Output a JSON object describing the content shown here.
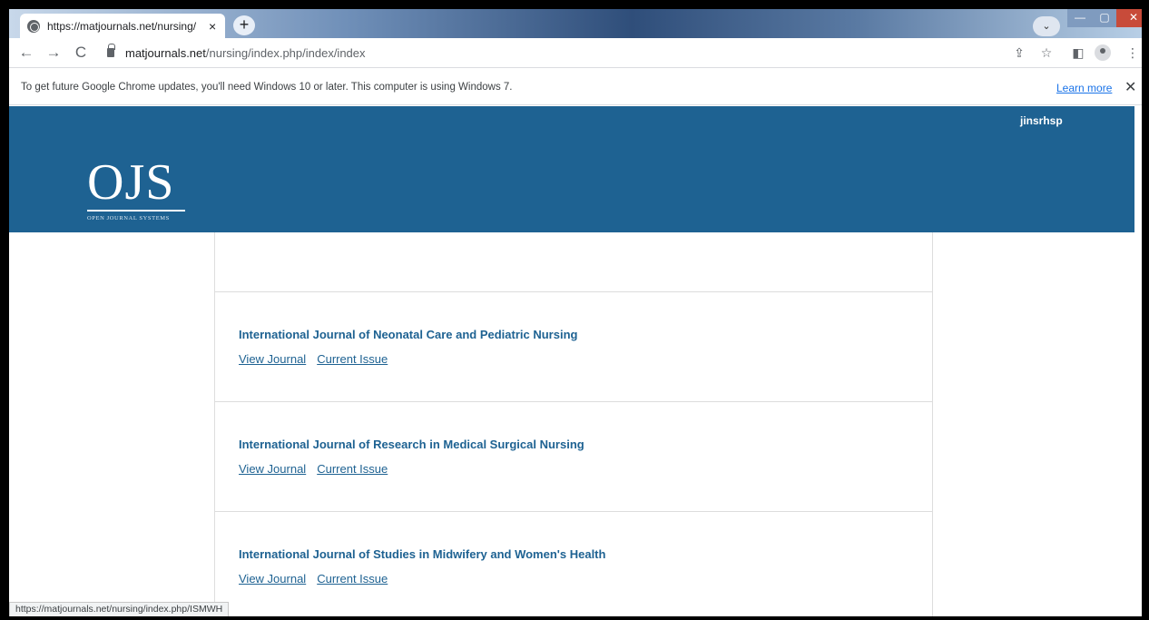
{
  "browser": {
    "tab": {
      "title": "https://matjournals.net/nursing/",
      "favicon": "globe-icon",
      "close": "×"
    },
    "new_tab": "+",
    "tab_search": "⌄",
    "window_controls": {
      "minimize": "—",
      "maximize": "▢",
      "close": "✕"
    },
    "url_host": "matjournals.net",
    "url_path": "/nursing/index.php/index/index",
    "icons": {
      "back": "←",
      "forward": "→",
      "reload": "C",
      "share": "⇪",
      "star": "☆",
      "side_panel": "◧",
      "menu": "⋮"
    }
  },
  "infobar": {
    "message": "To get future Google Chrome updates, you'll need Windows 10 or later. This computer is using Windows 7.",
    "learn_more": "Learn more",
    "close": "✕"
  },
  "site": {
    "header_color": "#1e6292",
    "logo_text": "OJS",
    "logo_subtitle": "OPEN JOURNAL SYSTEMS",
    "username": "jinsrhsp",
    "journals": [
      {
        "title": "International Journal of Neonatal Care and Pediatric Nursing",
        "view_label": "View Journal",
        "issue_label": "Current Issue"
      },
      {
        "title": "International Journal of Research in Medical Surgical Nursing",
        "view_label": "View Journal",
        "issue_label": "Current Issue"
      },
      {
        "title": "International Journal of Studies in Midwifery and Women's Health",
        "view_label": "View Journal",
        "issue_label": "Current Issue"
      }
    ]
  },
  "status_bar": {
    "url": "https://matjournals.net/nursing/index.php/ISMWH"
  }
}
